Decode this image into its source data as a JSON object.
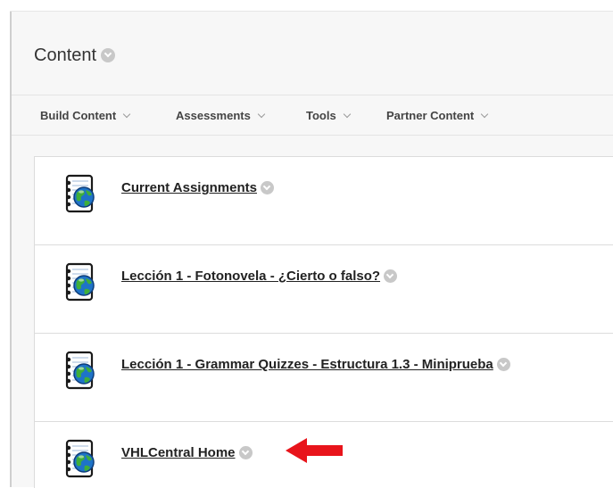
{
  "content_area": {
    "title": "Content"
  },
  "toolbar": {
    "items": [
      {
        "label": "Build Content"
      },
      {
        "label": "Assessments"
      },
      {
        "label": "Tools"
      },
      {
        "label": "Partner Content"
      }
    ]
  },
  "content_items": [
    {
      "title": "Current Assignments",
      "icon": "web-link-notebook-globe-icon"
    },
    {
      "title": "Lección 1 - Fotonovela - ¿Cierto o falso?",
      "icon": "web-link-notebook-globe-icon"
    },
    {
      "title": "Lección 1 - Grammar Quizzes - Estructura 1.3 - Miniprueba",
      "icon": "web-link-notebook-globe-icon"
    },
    {
      "title": "VHLCentral Home",
      "icon": "web-link-notebook-globe-icon"
    }
  ],
  "annotation": {
    "icon": "red-arrow-left-icon",
    "color": "#e8141b"
  },
  "colors": {
    "panel_background": "#f7f7f7",
    "list_background": "#ffffff",
    "chevron_circle": "#c8c8c8",
    "text": "#222222"
  }
}
